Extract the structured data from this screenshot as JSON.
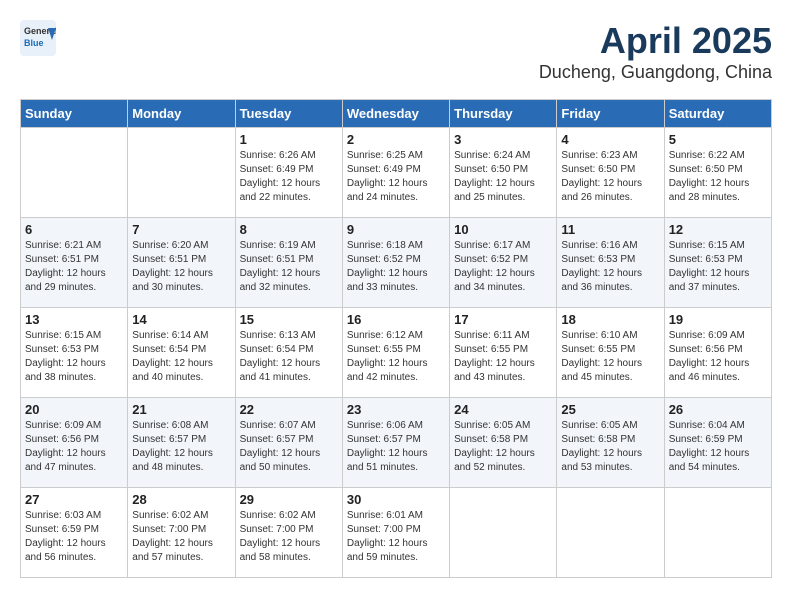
{
  "header": {
    "logo_general": "General",
    "logo_blue": "Blue",
    "month": "April 2025",
    "location": "Ducheng, Guangdong, China"
  },
  "days_of_week": [
    "Sunday",
    "Monday",
    "Tuesday",
    "Wednesday",
    "Thursday",
    "Friday",
    "Saturday"
  ],
  "weeks": [
    [
      {
        "day": "",
        "sunrise": "",
        "sunset": "",
        "daylight": ""
      },
      {
        "day": "",
        "sunrise": "",
        "sunset": "",
        "daylight": ""
      },
      {
        "day": "1",
        "sunrise": "Sunrise: 6:26 AM",
        "sunset": "Sunset: 6:49 PM",
        "daylight": "Daylight: 12 hours and 22 minutes."
      },
      {
        "day": "2",
        "sunrise": "Sunrise: 6:25 AM",
        "sunset": "Sunset: 6:49 PM",
        "daylight": "Daylight: 12 hours and 24 minutes."
      },
      {
        "day": "3",
        "sunrise": "Sunrise: 6:24 AM",
        "sunset": "Sunset: 6:50 PM",
        "daylight": "Daylight: 12 hours and 25 minutes."
      },
      {
        "day": "4",
        "sunrise": "Sunrise: 6:23 AM",
        "sunset": "Sunset: 6:50 PM",
        "daylight": "Daylight: 12 hours and 26 minutes."
      },
      {
        "day": "5",
        "sunrise": "Sunrise: 6:22 AM",
        "sunset": "Sunset: 6:50 PM",
        "daylight": "Daylight: 12 hours and 28 minutes."
      }
    ],
    [
      {
        "day": "6",
        "sunrise": "Sunrise: 6:21 AM",
        "sunset": "Sunset: 6:51 PM",
        "daylight": "Daylight: 12 hours and 29 minutes."
      },
      {
        "day": "7",
        "sunrise": "Sunrise: 6:20 AM",
        "sunset": "Sunset: 6:51 PM",
        "daylight": "Daylight: 12 hours and 30 minutes."
      },
      {
        "day": "8",
        "sunrise": "Sunrise: 6:19 AM",
        "sunset": "Sunset: 6:51 PM",
        "daylight": "Daylight: 12 hours and 32 minutes."
      },
      {
        "day": "9",
        "sunrise": "Sunrise: 6:18 AM",
        "sunset": "Sunset: 6:52 PM",
        "daylight": "Daylight: 12 hours and 33 minutes."
      },
      {
        "day": "10",
        "sunrise": "Sunrise: 6:17 AM",
        "sunset": "Sunset: 6:52 PM",
        "daylight": "Daylight: 12 hours and 34 minutes."
      },
      {
        "day": "11",
        "sunrise": "Sunrise: 6:16 AM",
        "sunset": "Sunset: 6:53 PM",
        "daylight": "Daylight: 12 hours and 36 minutes."
      },
      {
        "day": "12",
        "sunrise": "Sunrise: 6:15 AM",
        "sunset": "Sunset: 6:53 PM",
        "daylight": "Daylight: 12 hours and 37 minutes."
      }
    ],
    [
      {
        "day": "13",
        "sunrise": "Sunrise: 6:15 AM",
        "sunset": "Sunset: 6:53 PM",
        "daylight": "Daylight: 12 hours and 38 minutes."
      },
      {
        "day": "14",
        "sunrise": "Sunrise: 6:14 AM",
        "sunset": "Sunset: 6:54 PM",
        "daylight": "Daylight: 12 hours and 40 minutes."
      },
      {
        "day": "15",
        "sunrise": "Sunrise: 6:13 AM",
        "sunset": "Sunset: 6:54 PM",
        "daylight": "Daylight: 12 hours and 41 minutes."
      },
      {
        "day": "16",
        "sunrise": "Sunrise: 6:12 AM",
        "sunset": "Sunset: 6:55 PM",
        "daylight": "Daylight: 12 hours and 42 minutes."
      },
      {
        "day": "17",
        "sunrise": "Sunrise: 6:11 AM",
        "sunset": "Sunset: 6:55 PM",
        "daylight": "Daylight: 12 hours and 43 minutes."
      },
      {
        "day": "18",
        "sunrise": "Sunrise: 6:10 AM",
        "sunset": "Sunset: 6:55 PM",
        "daylight": "Daylight: 12 hours and 45 minutes."
      },
      {
        "day": "19",
        "sunrise": "Sunrise: 6:09 AM",
        "sunset": "Sunset: 6:56 PM",
        "daylight": "Daylight: 12 hours and 46 minutes."
      }
    ],
    [
      {
        "day": "20",
        "sunrise": "Sunrise: 6:09 AM",
        "sunset": "Sunset: 6:56 PM",
        "daylight": "Daylight: 12 hours and 47 minutes."
      },
      {
        "day": "21",
        "sunrise": "Sunrise: 6:08 AM",
        "sunset": "Sunset: 6:57 PM",
        "daylight": "Daylight: 12 hours and 48 minutes."
      },
      {
        "day": "22",
        "sunrise": "Sunrise: 6:07 AM",
        "sunset": "Sunset: 6:57 PM",
        "daylight": "Daylight: 12 hours and 50 minutes."
      },
      {
        "day": "23",
        "sunrise": "Sunrise: 6:06 AM",
        "sunset": "Sunset: 6:57 PM",
        "daylight": "Daylight: 12 hours and 51 minutes."
      },
      {
        "day": "24",
        "sunrise": "Sunrise: 6:05 AM",
        "sunset": "Sunset: 6:58 PM",
        "daylight": "Daylight: 12 hours and 52 minutes."
      },
      {
        "day": "25",
        "sunrise": "Sunrise: 6:05 AM",
        "sunset": "Sunset: 6:58 PM",
        "daylight": "Daylight: 12 hours and 53 minutes."
      },
      {
        "day": "26",
        "sunrise": "Sunrise: 6:04 AM",
        "sunset": "Sunset: 6:59 PM",
        "daylight": "Daylight: 12 hours and 54 minutes."
      }
    ],
    [
      {
        "day": "27",
        "sunrise": "Sunrise: 6:03 AM",
        "sunset": "Sunset: 6:59 PM",
        "daylight": "Daylight: 12 hours and 56 minutes."
      },
      {
        "day": "28",
        "sunrise": "Sunrise: 6:02 AM",
        "sunset": "Sunset: 7:00 PM",
        "daylight": "Daylight: 12 hours and 57 minutes."
      },
      {
        "day": "29",
        "sunrise": "Sunrise: 6:02 AM",
        "sunset": "Sunset: 7:00 PM",
        "daylight": "Daylight: 12 hours and 58 minutes."
      },
      {
        "day": "30",
        "sunrise": "Sunrise: 6:01 AM",
        "sunset": "Sunset: 7:00 PM",
        "daylight": "Daylight: 12 hours and 59 minutes."
      },
      {
        "day": "",
        "sunrise": "",
        "sunset": "",
        "daylight": ""
      },
      {
        "day": "",
        "sunrise": "",
        "sunset": "",
        "daylight": ""
      },
      {
        "day": "",
        "sunrise": "",
        "sunset": "",
        "daylight": ""
      }
    ]
  ]
}
